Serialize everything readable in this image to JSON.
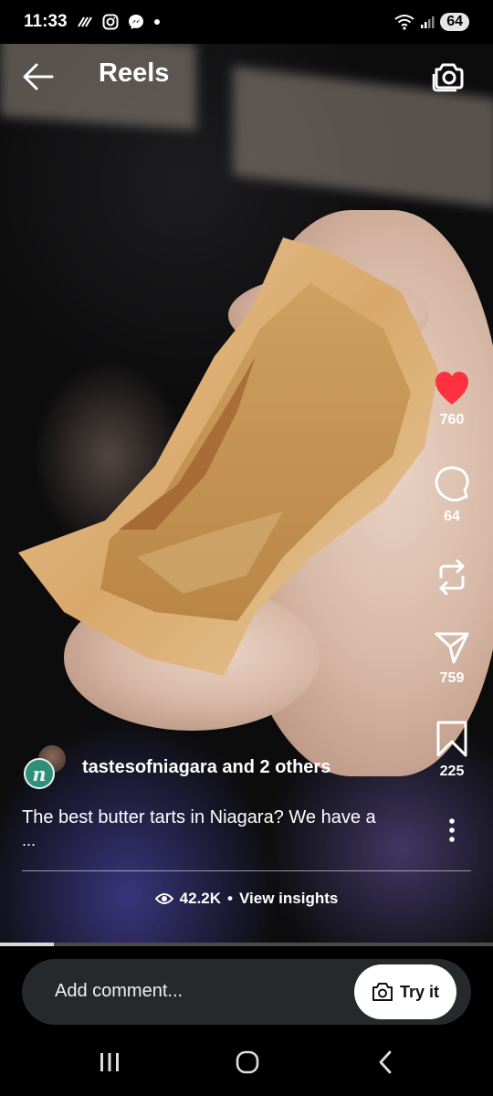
{
  "status_bar": {
    "time": "11:33",
    "battery": "64",
    "left_icons": [
      "voicemail-icon",
      "instagram-icon",
      "messenger-icon",
      "dot-icon"
    ],
    "right_icons": [
      "wifi-icon",
      "signal-icon"
    ]
  },
  "header": {
    "title": "Reels",
    "back_icon": "back-arrow-icon",
    "camera_icon": "camera-icon"
  },
  "actions": {
    "like_count": "760",
    "comment_count": "64",
    "repost_icon": "repost-icon",
    "share_count": "759",
    "save_count": "225",
    "more_icon": "more-vertical-icon"
  },
  "post": {
    "author": "tastesofniagara",
    "collaborators": "and 2 others",
    "avatar_letter": "n",
    "caption": "The best butter tarts in Niagara? We have a",
    "caption_more": "...",
    "views": "42.2K",
    "separator": "•",
    "insights_label": "View insights"
  },
  "playback": {
    "progress_fraction": 0.11
  },
  "comment_bar": {
    "placeholder": "Add comment...",
    "try_label": "Try it"
  },
  "colors": {
    "like_red": "#ff3040",
    "background": "#000000",
    "comment_box": "#26292c",
    "avatar_teal": "#2e8f7a"
  }
}
